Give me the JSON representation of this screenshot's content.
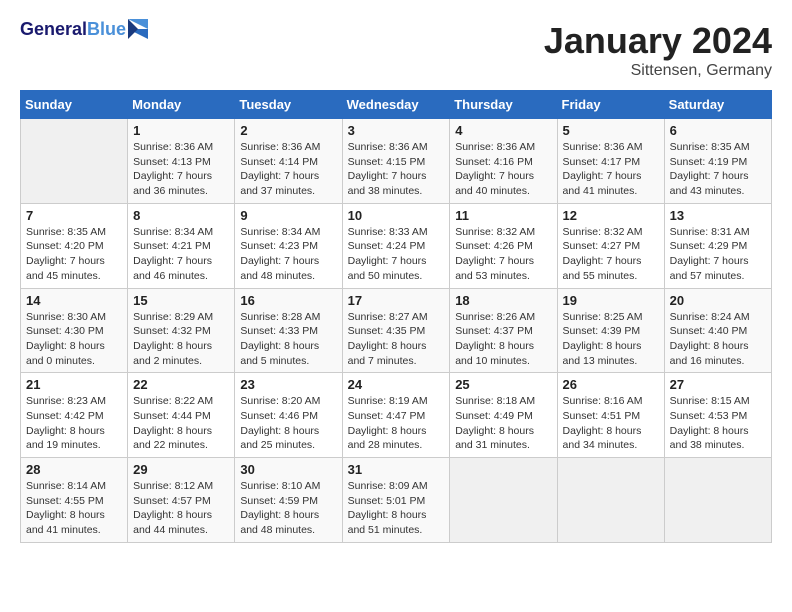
{
  "header": {
    "logo_line1": "General",
    "logo_line2": "Blue",
    "month": "January 2024",
    "location": "Sittensen, Germany"
  },
  "weekdays": [
    "Sunday",
    "Monday",
    "Tuesday",
    "Wednesday",
    "Thursday",
    "Friday",
    "Saturday"
  ],
  "weeks": [
    [
      {
        "day": "",
        "info": ""
      },
      {
        "day": "1",
        "info": "Sunrise: 8:36 AM\nSunset: 4:13 PM\nDaylight: 7 hours\nand 36 minutes."
      },
      {
        "day": "2",
        "info": "Sunrise: 8:36 AM\nSunset: 4:14 PM\nDaylight: 7 hours\nand 37 minutes."
      },
      {
        "day": "3",
        "info": "Sunrise: 8:36 AM\nSunset: 4:15 PM\nDaylight: 7 hours\nand 38 minutes."
      },
      {
        "day": "4",
        "info": "Sunrise: 8:36 AM\nSunset: 4:16 PM\nDaylight: 7 hours\nand 40 minutes."
      },
      {
        "day": "5",
        "info": "Sunrise: 8:36 AM\nSunset: 4:17 PM\nDaylight: 7 hours\nand 41 minutes."
      },
      {
        "day": "6",
        "info": "Sunrise: 8:35 AM\nSunset: 4:19 PM\nDaylight: 7 hours\nand 43 minutes."
      }
    ],
    [
      {
        "day": "7",
        "info": "Sunrise: 8:35 AM\nSunset: 4:20 PM\nDaylight: 7 hours\nand 45 minutes."
      },
      {
        "day": "8",
        "info": "Sunrise: 8:34 AM\nSunset: 4:21 PM\nDaylight: 7 hours\nand 46 minutes."
      },
      {
        "day": "9",
        "info": "Sunrise: 8:34 AM\nSunset: 4:23 PM\nDaylight: 7 hours\nand 48 minutes."
      },
      {
        "day": "10",
        "info": "Sunrise: 8:33 AM\nSunset: 4:24 PM\nDaylight: 7 hours\nand 50 minutes."
      },
      {
        "day": "11",
        "info": "Sunrise: 8:32 AM\nSunset: 4:26 PM\nDaylight: 7 hours\nand 53 minutes."
      },
      {
        "day": "12",
        "info": "Sunrise: 8:32 AM\nSunset: 4:27 PM\nDaylight: 7 hours\nand 55 minutes."
      },
      {
        "day": "13",
        "info": "Sunrise: 8:31 AM\nSunset: 4:29 PM\nDaylight: 7 hours\nand 57 minutes."
      }
    ],
    [
      {
        "day": "14",
        "info": "Sunrise: 8:30 AM\nSunset: 4:30 PM\nDaylight: 8 hours\nand 0 minutes."
      },
      {
        "day": "15",
        "info": "Sunrise: 8:29 AM\nSunset: 4:32 PM\nDaylight: 8 hours\nand 2 minutes."
      },
      {
        "day": "16",
        "info": "Sunrise: 8:28 AM\nSunset: 4:33 PM\nDaylight: 8 hours\nand 5 minutes."
      },
      {
        "day": "17",
        "info": "Sunrise: 8:27 AM\nSunset: 4:35 PM\nDaylight: 8 hours\nand 7 minutes."
      },
      {
        "day": "18",
        "info": "Sunrise: 8:26 AM\nSunset: 4:37 PM\nDaylight: 8 hours\nand 10 minutes."
      },
      {
        "day": "19",
        "info": "Sunrise: 8:25 AM\nSunset: 4:39 PM\nDaylight: 8 hours\nand 13 minutes."
      },
      {
        "day": "20",
        "info": "Sunrise: 8:24 AM\nSunset: 4:40 PM\nDaylight: 8 hours\nand 16 minutes."
      }
    ],
    [
      {
        "day": "21",
        "info": "Sunrise: 8:23 AM\nSunset: 4:42 PM\nDaylight: 8 hours\nand 19 minutes."
      },
      {
        "day": "22",
        "info": "Sunrise: 8:22 AM\nSunset: 4:44 PM\nDaylight: 8 hours\nand 22 minutes."
      },
      {
        "day": "23",
        "info": "Sunrise: 8:20 AM\nSunset: 4:46 PM\nDaylight: 8 hours\nand 25 minutes."
      },
      {
        "day": "24",
        "info": "Sunrise: 8:19 AM\nSunset: 4:47 PM\nDaylight: 8 hours\nand 28 minutes."
      },
      {
        "day": "25",
        "info": "Sunrise: 8:18 AM\nSunset: 4:49 PM\nDaylight: 8 hours\nand 31 minutes."
      },
      {
        "day": "26",
        "info": "Sunrise: 8:16 AM\nSunset: 4:51 PM\nDaylight: 8 hours\nand 34 minutes."
      },
      {
        "day": "27",
        "info": "Sunrise: 8:15 AM\nSunset: 4:53 PM\nDaylight: 8 hours\nand 38 minutes."
      }
    ],
    [
      {
        "day": "28",
        "info": "Sunrise: 8:14 AM\nSunset: 4:55 PM\nDaylight: 8 hours\nand 41 minutes."
      },
      {
        "day": "29",
        "info": "Sunrise: 8:12 AM\nSunset: 4:57 PM\nDaylight: 8 hours\nand 44 minutes."
      },
      {
        "day": "30",
        "info": "Sunrise: 8:10 AM\nSunset: 4:59 PM\nDaylight: 8 hours\nand 48 minutes."
      },
      {
        "day": "31",
        "info": "Sunrise: 8:09 AM\nSunset: 5:01 PM\nDaylight: 8 hours\nand 51 minutes."
      },
      {
        "day": "",
        "info": ""
      },
      {
        "day": "",
        "info": ""
      },
      {
        "day": "",
        "info": ""
      }
    ]
  ]
}
